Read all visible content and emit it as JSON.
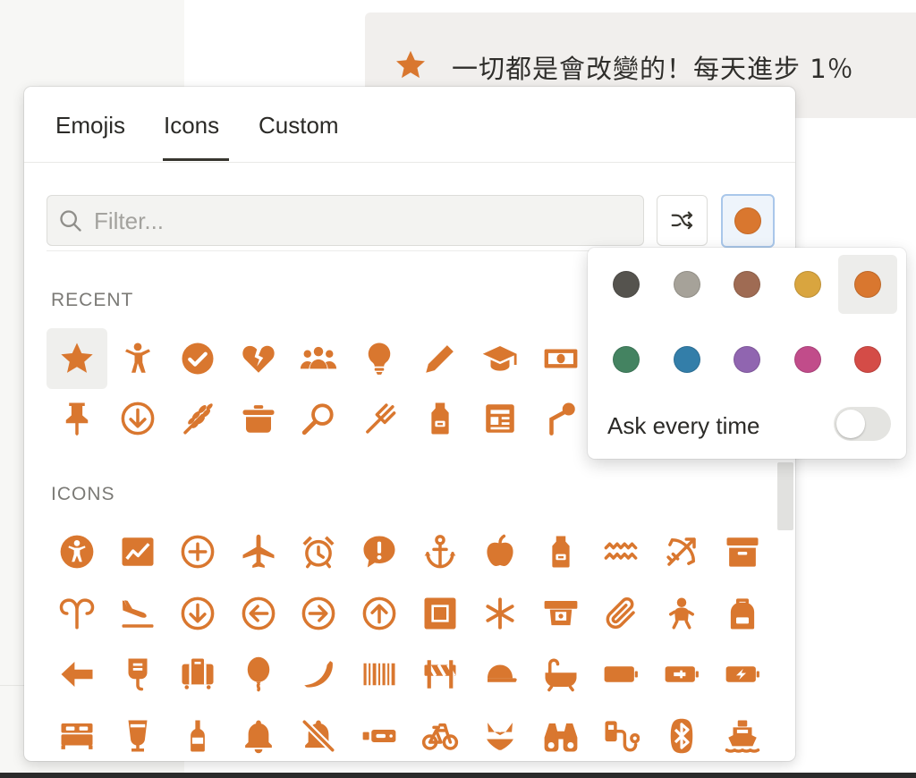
{
  "page": {
    "callout_text": "一切都是會改變的！每天進步 1％",
    "callout_icon": "star-icon"
  },
  "picker": {
    "tabs": [
      {
        "label": "Emojis",
        "active": false
      },
      {
        "label": "Icons",
        "active": true
      },
      {
        "label": "Custom",
        "active": false
      }
    ],
    "filter_placeholder": "Filter...",
    "shuffle_icon": "shuffle-icon",
    "icon_color": "#d9772f",
    "recent_title": "RECENT",
    "icons_title": "ICONS",
    "recent_icons": [
      "star",
      "accessibility-person",
      "checkmark-circle",
      "heart-broken",
      "people-group",
      "lightbulb",
      "pencil",
      "graduation-cap",
      "banknote",
      "pushpin",
      "arrow-down-circle",
      "wheat",
      "cooking-pot",
      "frying-pan",
      "fork",
      "apron",
      "newspaper",
      "microphone-stand"
    ],
    "icons": [
      "accessibility",
      "activity-chart",
      "add-circle",
      "airplane",
      "alarm-clock",
      "alert-bubble",
      "anchor",
      "apple",
      "apron",
      "aquarius",
      "archery",
      "archive",
      "aries",
      "arrivals",
      "arrow-down-circle",
      "arrow-left-circle",
      "arrow-right-circle",
      "arrow-up-circle",
      "artwork",
      "asterisk",
      "atm",
      "attachment",
      "baby",
      "backpack",
      "arrow-left",
      "bag-iv",
      "baggage",
      "balloon",
      "banana",
      "barcode",
      "barricade",
      "baseball-cap",
      "bathtub",
      "battery-full",
      "battery-charging",
      "battery-bolt",
      "bed",
      "beer",
      "beer-bottle",
      "bell",
      "bell-off",
      "belt",
      "bicycle",
      "bikini",
      "binoculars",
      "blood-pressure",
      "bluetooth",
      "boat"
    ]
  },
  "color_picker": {
    "colors": [
      {
        "name": "gray-dark",
        "hex": "#55534e"
      },
      {
        "name": "gray",
        "hex": "#a6a299"
      },
      {
        "name": "brown",
        "hex": "#9f6b53"
      },
      {
        "name": "yellow",
        "hex": "#d9a53f"
      },
      {
        "name": "orange",
        "hex": "#d9772f",
        "selected": true
      },
      {
        "name": "green",
        "hex": "#448361"
      },
      {
        "name": "blue",
        "hex": "#337ea9"
      },
      {
        "name": "purple",
        "hex": "#9065b0"
      },
      {
        "name": "pink",
        "hex": "#c14c8a"
      },
      {
        "name": "red",
        "hex": "#d44c47"
      }
    ],
    "ask_label": "Ask every time",
    "ask_enabled": false
  }
}
